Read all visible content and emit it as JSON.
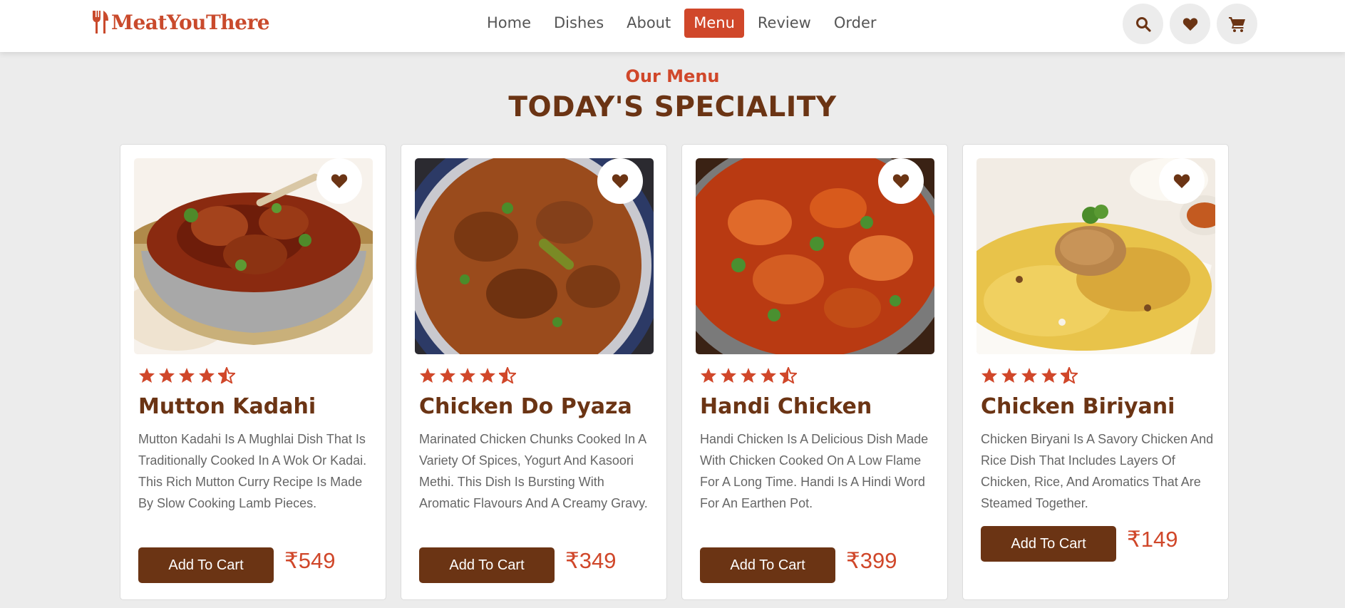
{
  "brand": {
    "name": "MeatYouThere",
    "color": "#c94a2c"
  },
  "nav": {
    "items": [
      {
        "label": "Home"
      },
      {
        "label": "Dishes"
      },
      {
        "label": "About"
      },
      {
        "label": "Menu",
        "active": true
      },
      {
        "label": "Review"
      },
      {
        "label": "Order"
      }
    ]
  },
  "header_icons": [
    "search-icon",
    "heart-icon",
    "cart-icon"
  ],
  "section": {
    "subtitle": "Our Menu",
    "title": "TODAY'S SPECIALITY"
  },
  "colors": {
    "accent": "#d0472a",
    "brown": "#6b3414",
    "background": "#ececec"
  },
  "cards": [
    {
      "title": "Mutton Kadahi",
      "rating": 4.5,
      "description": "Mutton Kadahi Is A Mughlai Dish That Is Traditionally Cooked In A Wok Or Kadai. This Rich Mutton Curry Recipe Is Made By Slow Cooking Lamb Pieces.",
      "button": "Add To Cart",
      "price": "₹549"
    },
    {
      "title": "Chicken Do Pyaza",
      "rating": 4.5,
      "description": "Marinated Chicken Chunks Cooked In A Variety Of Spices, Yogurt And Kasoori Methi. This Dish Is Bursting With Aromatic Flavours And A Creamy Gravy.",
      "button": "Add To Cart",
      "price": "₹349"
    },
    {
      "title": "Handi Chicken",
      "rating": 4.5,
      "description": "Handi Chicken Is A Delicious Dish Made With Chicken Cooked On A Low Flame For A Long Time. Handi Is A Hindi Word For An Earthen Pot.",
      "button": "Add To Cart",
      "price": "₹399"
    },
    {
      "title": "Chicken Biriyani",
      "rating": 4.5,
      "description": "Chicken Biryani Is A Savory Chicken And Rice Dish That Includes Layers Of Chicken, Rice, And Aromatics That Are Steamed Together.",
      "button": "Add To Cart",
      "price": "₹149"
    }
  ]
}
